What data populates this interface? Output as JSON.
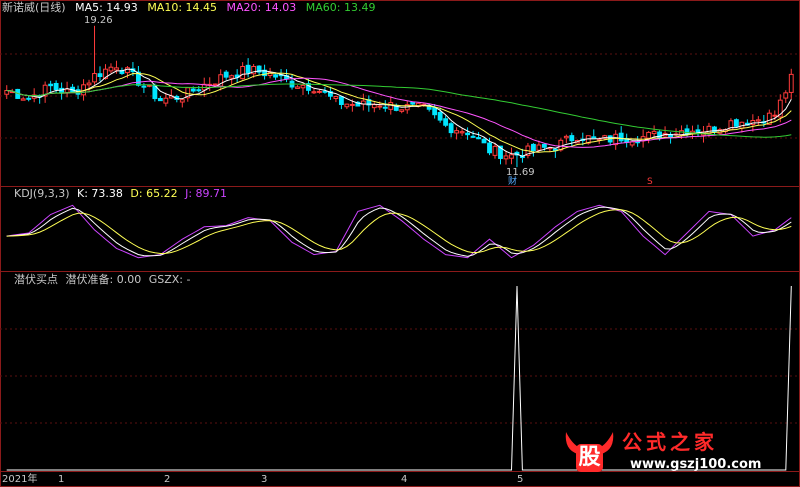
{
  "colors": {
    "bg": "#000000",
    "frame": "#8b1a1a",
    "grid": "#5a1010",
    "up": "#ff3b3b",
    "down": "#00e5ff",
    "text": "#c8c8c8",
    "ma5": "#ffffff",
    "ma10": "#ffff55",
    "ma20": "#ff55ff",
    "ma60": "#33cc33",
    "k": "#ffffff",
    "d": "#ffff55",
    "j": "#cc44ff",
    "signal": "#ffffff"
  },
  "header": {
    "stock": "新诺威(日线)",
    "ma5": "MA5: 14.93",
    "ma10": "MA10: 14.45",
    "ma20": "MA20: 14.03",
    "ma60": "MA60: 13.49"
  },
  "kdj_header": {
    "name": "KDJ(9,3,3)",
    "k": "K: 73.38",
    "d": "D: 65.22",
    "j": "J: 89.71"
  },
  "signal_header": {
    "name": "潜伏买点",
    "prep": "潜伏准备: 0.00",
    "gszx": "GSZX: -"
  },
  "annotations": {
    "high": "19.26",
    "low": "11.69",
    "mark_r": "财",
    "mark_s": "S"
  },
  "xaxis": {
    "year": "2021年",
    "months": [
      "1",
      "2",
      "3",
      "4",
      "5"
    ]
  },
  "watermark": {
    "badge": "股",
    "title": "公式之家",
    "url": "www.gszj100.com"
  },
  "chart_data": [
    {
      "type": "candlestick",
      "title": "新诺威(日线)",
      "ylim": [
        11.0,
        20.0
      ],
      "ohlc_note": "approximate daily candles read off the price panel",
      "anchors": [
        [
          0,
          15.8
        ],
        [
          4,
          15.4
        ],
        [
          8,
          16.0
        ],
        [
          12,
          15.6
        ],
        [
          16,
          16.6
        ],
        [
          20,
          17.2
        ],
        [
          24,
          16.3
        ],
        [
          28,
          15.3
        ],
        [
          32,
          15.5
        ],
        [
          36,
          16.1
        ],
        [
          40,
          16.6
        ],
        [
          44,
          16.9
        ],
        [
          48,
          16.7
        ],
        [
          52,
          16.2
        ],
        [
          56,
          16.0
        ],
        [
          60,
          15.2
        ],
        [
          64,
          15.0
        ],
        [
          68,
          15.1
        ],
        [
          72,
          14.9
        ],
        [
          76,
          14.8
        ],
        [
          80,
          13.9
        ],
        [
          84,
          13.6
        ],
        [
          88,
          12.6
        ],
        [
          92,
          12.3
        ],
        [
          96,
          12.6
        ],
        [
          100,
          12.8
        ],
        [
          104,
          13.4
        ],
        [
          108,
          13.1
        ],
        [
          112,
          13.3
        ],
        [
          116,
          13.3
        ],
        [
          120,
          13.5
        ],
        [
          124,
          13.7
        ],
        [
          128,
          13.7
        ],
        [
          132,
          14.1
        ],
        [
          136,
          14.2
        ],
        [
          140,
          14.5
        ],
        [
          143,
          16.4
        ]
      ],
      "high_point": {
        "index": 16,
        "value": 19.26
      },
      "low_point": {
        "index": 93,
        "value": 11.69
      },
      "series": [
        {
          "name": "MA5",
          "last": 14.93
        },
        {
          "name": "MA10",
          "last": 14.45
        },
        {
          "name": "MA20",
          "last": 14.03
        },
        {
          "name": "MA60",
          "last": 13.49
        }
      ]
    },
    {
      "type": "line",
      "title": "KDJ(9,3,3)",
      "ylim": [
        -10,
        110
      ],
      "j_anchors": [
        [
          0,
          45
        ],
        [
          4,
          50
        ],
        [
          8,
          80
        ],
        [
          12,
          95
        ],
        [
          16,
          55
        ],
        [
          20,
          25
        ],
        [
          24,
          10
        ],
        [
          28,
          15
        ],
        [
          32,
          40
        ],
        [
          36,
          60
        ],
        [
          40,
          62
        ],
        [
          44,
          75
        ],
        [
          48,
          70
        ],
        [
          52,
          35
        ],
        [
          56,
          15
        ],
        [
          60,
          20
        ],
        [
          64,
          85
        ],
        [
          68,
          95
        ],
        [
          72,
          70
        ],
        [
          76,
          40
        ],
        [
          80,
          15
        ],
        [
          84,
          10
        ],
        [
          88,
          40
        ],
        [
          92,
          10
        ],
        [
          96,
          30
        ],
        [
          100,
          60
        ],
        [
          104,
          85
        ],
        [
          108,
          95
        ],
        [
          112,
          85
        ],
        [
          116,
          45
        ],
        [
          120,
          15
        ],
        [
          124,
          50
        ],
        [
          128,
          85
        ],
        [
          132,
          80
        ],
        [
          136,
          45
        ],
        [
          140,
          55
        ],
        [
          143,
          75
        ]
      ],
      "series": [
        {
          "name": "K",
          "last": 73.38
        },
        {
          "name": "D",
          "last": 65.22
        },
        {
          "name": "J",
          "last": 89.71
        }
      ]
    },
    {
      "type": "line",
      "title": "潜伏买点",
      "ylim": [
        0,
        1
      ],
      "series": [
        {
          "name": "潜伏准备",
          "spikes": [
            93,
            143
          ],
          "values": "0 except spikes = 1"
        }
      ]
    }
  ]
}
